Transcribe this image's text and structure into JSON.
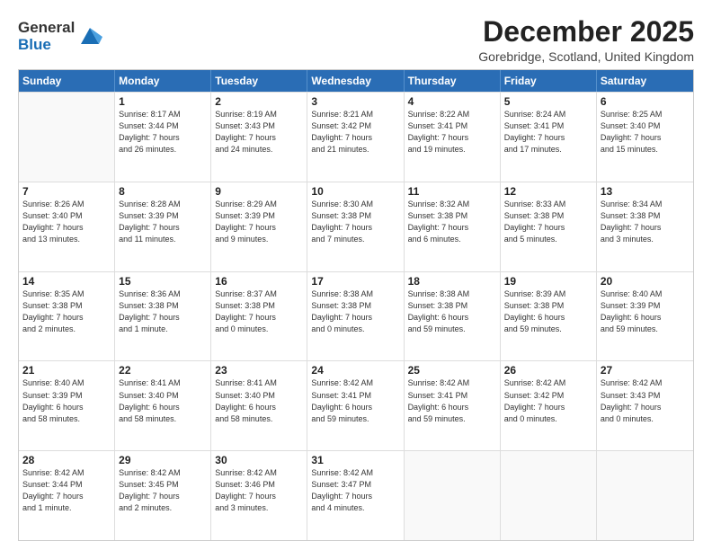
{
  "logo": {
    "line1": "General",
    "line2": "Blue"
  },
  "title": "December 2025",
  "subtitle": "Gorebridge, Scotland, United Kingdom",
  "header_days": [
    "Sunday",
    "Monday",
    "Tuesday",
    "Wednesday",
    "Thursday",
    "Friday",
    "Saturday"
  ],
  "weeks": [
    [
      {
        "day": "",
        "info": ""
      },
      {
        "day": "1",
        "info": "Sunrise: 8:17 AM\nSunset: 3:44 PM\nDaylight: 7 hours\nand 26 minutes."
      },
      {
        "day": "2",
        "info": "Sunrise: 8:19 AM\nSunset: 3:43 PM\nDaylight: 7 hours\nand 24 minutes."
      },
      {
        "day": "3",
        "info": "Sunrise: 8:21 AM\nSunset: 3:42 PM\nDaylight: 7 hours\nand 21 minutes."
      },
      {
        "day": "4",
        "info": "Sunrise: 8:22 AM\nSunset: 3:41 PM\nDaylight: 7 hours\nand 19 minutes."
      },
      {
        "day": "5",
        "info": "Sunrise: 8:24 AM\nSunset: 3:41 PM\nDaylight: 7 hours\nand 17 minutes."
      },
      {
        "day": "6",
        "info": "Sunrise: 8:25 AM\nSunset: 3:40 PM\nDaylight: 7 hours\nand 15 minutes."
      }
    ],
    [
      {
        "day": "7",
        "info": "Sunrise: 8:26 AM\nSunset: 3:40 PM\nDaylight: 7 hours\nand 13 minutes."
      },
      {
        "day": "8",
        "info": "Sunrise: 8:28 AM\nSunset: 3:39 PM\nDaylight: 7 hours\nand 11 minutes."
      },
      {
        "day": "9",
        "info": "Sunrise: 8:29 AM\nSunset: 3:39 PM\nDaylight: 7 hours\nand 9 minutes."
      },
      {
        "day": "10",
        "info": "Sunrise: 8:30 AM\nSunset: 3:38 PM\nDaylight: 7 hours\nand 7 minutes."
      },
      {
        "day": "11",
        "info": "Sunrise: 8:32 AM\nSunset: 3:38 PM\nDaylight: 7 hours\nand 6 minutes."
      },
      {
        "day": "12",
        "info": "Sunrise: 8:33 AM\nSunset: 3:38 PM\nDaylight: 7 hours\nand 5 minutes."
      },
      {
        "day": "13",
        "info": "Sunrise: 8:34 AM\nSunset: 3:38 PM\nDaylight: 7 hours\nand 3 minutes."
      }
    ],
    [
      {
        "day": "14",
        "info": "Sunrise: 8:35 AM\nSunset: 3:38 PM\nDaylight: 7 hours\nand 2 minutes."
      },
      {
        "day": "15",
        "info": "Sunrise: 8:36 AM\nSunset: 3:38 PM\nDaylight: 7 hours\nand 1 minute."
      },
      {
        "day": "16",
        "info": "Sunrise: 8:37 AM\nSunset: 3:38 PM\nDaylight: 7 hours\nand 0 minutes."
      },
      {
        "day": "17",
        "info": "Sunrise: 8:38 AM\nSunset: 3:38 PM\nDaylight: 7 hours\nand 0 minutes."
      },
      {
        "day": "18",
        "info": "Sunrise: 8:38 AM\nSunset: 3:38 PM\nDaylight: 6 hours\nand 59 minutes."
      },
      {
        "day": "19",
        "info": "Sunrise: 8:39 AM\nSunset: 3:38 PM\nDaylight: 6 hours\nand 59 minutes."
      },
      {
        "day": "20",
        "info": "Sunrise: 8:40 AM\nSunset: 3:39 PM\nDaylight: 6 hours\nand 59 minutes."
      }
    ],
    [
      {
        "day": "21",
        "info": "Sunrise: 8:40 AM\nSunset: 3:39 PM\nDaylight: 6 hours\nand 58 minutes."
      },
      {
        "day": "22",
        "info": "Sunrise: 8:41 AM\nSunset: 3:40 PM\nDaylight: 6 hours\nand 58 minutes."
      },
      {
        "day": "23",
        "info": "Sunrise: 8:41 AM\nSunset: 3:40 PM\nDaylight: 6 hours\nand 58 minutes."
      },
      {
        "day": "24",
        "info": "Sunrise: 8:42 AM\nSunset: 3:41 PM\nDaylight: 6 hours\nand 59 minutes."
      },
      {
        "day": "25",
        "info": "Sunrise: 8:42 AM\nSunset: 3:41 PM\nDaylight: 6 hours\nand 59 minutes."
      },
      {
        "day": "26",
        "info": "Sunrise: 8:42 AM\nSunset: 3:42 PM\nDaylight: 7 hours\nand 0 minutes."
      },
      {
        "day": "27",
        "info": "Sunrise: 8:42 AM\nSunset: 3:43 PM\nDaylight: 7 hours\nand 0 minutes."
      }
    ],
    [
      {
        "day": "28",
        "info": "Sunrise: 8:42 AM\nSunset: 3:44 PM\nDaylight: 7 hours\nand 1 minute."
      },
      {
        "day": "29",
        "info": "Sunrise: 8:42 AM\nSunset: 3:45 PM\nDaylight: 7 hours\nand 2 minutes."
      },
      {
        "day": "30",
        "info": "Sunrise: 8:42 AM\nSunset: 3:46 PM\nDaylight: 7 hours\nand 3 minutes."
      },
      {
        "day": "31",
        "info": "Sunrise: 8:42 AM\nSunset: 3:47 PM\nDaylight: 7 hours\nand 4 minutes."
      },
      {
        "day": "",
        "info": ""
      },
      {
        "day": "",
        "info": ""
      },
      {
        "day": "",
        "info": ""
      }
    ]
  ]
}
